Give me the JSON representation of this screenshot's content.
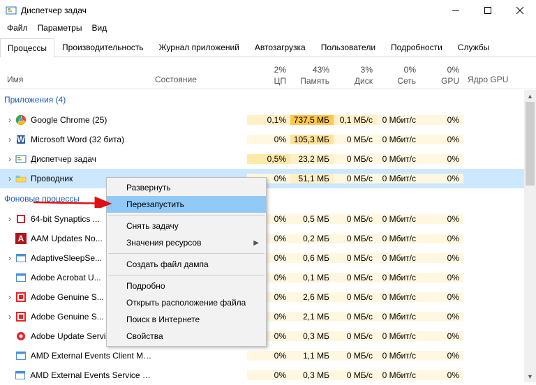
{
  "window": {
    "title": "Диспетчер задач"
  },
  "menu": [
    "Файл",
    "Параметры",
    "Вид"
  ],
  "tabs": [
    "Процессы",
    "Производительность",
    "Журнал приложений",
    "Автозагрузка",
    "Пользователи",
    "Подробности",
    "Службы"
  ],
  "header": {
    "name": "Имя",
    "state": "Состояние",
    "cols": [
      {
        "pct": "2%",
        "label": "ЦП"
      },
      {
        "pct": "43%",
        "label": "Память"
      },
      {
        "pct": "3%",
        "label": "Диск"
      },
      {
        "pct": "0%",
        "label": "Сеть"
      },
      {
        "pct": "0%",
        "label": "GPU"
      }
    ],
    "gpu_engine": "Ядро GPU"
  },
  "groups": {
    "apps": "Приложения (4)",
    "bg": "Фоновые процессы"
  },
  "rows": [
    {
      "exp": true,
      "icon": "chrome",
      "name": "Google Chrome (25)",
      "cpu": "0,1%",
      "mem": "737,5 МБ",
      "disk": "0,1 МБ/с",
      "net": "0 Мбит/с",
      "gpu": "0%",
      "cpu_bg": "bg1",
      "mem_bg": "bgm3",
      "disk_bg": "bg1",
      "net_bg": "bg0",
      "gpu_bg": "bg0"
    },
    {
      "exp": true,
      "icon": "word",
      "name": "Microsoft Word (32 бита)",
      "cpu": "0%",
      "mem": "105,3 МБ",
      "disk": "0 МБ/с",
      "net": "0 Мбит/с",
      "gpu": "0%",
      "cpu_bg": "bg0",
      "mem_bg": "bgm2",
      "disk_bg": "bg0",
      "net_bg": "bg0",
      "gpu_bg": "bg0"
    },
    {
      "exp": true,
      "icon": "tm",
      "name": "Диспетчер задач",
      "cpu": "0,5%",
      "mem": "23,2 МБ",
      "disk": "0 МБ/с",
      "net": "0 Мбит/с",
      "gpu": "0%",
      "cpu_bg": "bg2",
      "mem_bg": "bgm1",
      "disk_bg": "bg0",
      "net_bg": "bg0",
      "gpu_bg": "bg0"
    },
    {
      "exp": true,
      "icon": "explorer",
      "name": "Проводник",
      "cpu": "0%",
      "mem": "51,1 МБ",
      "disk": "0 МБ/с",
      "net": "0 Мбит/с",
      "gpu": "0%",
      "cpu_bg": "bg0",
      "mem_bg": "bgm1",
      "disk_bg": "bg0",
      "net_bg": "bg0",
      "gpu_bg": "bg0",
      "sel": true
    }
  ],
  "bg_rows": [
    {
      "exp": true,
      "icon": "box-red",
      "name": "64-bit Synaptics ...",
      "cpu": "0%",
      "mem": "0,5 МБ",
      "disk": "0 МБ/с",
      "net": "0 Мбит/с",
      "gpu": "0%"
    },
    {
      "exp": false,
      "icon": "adobe-a",
      "name": "AAM Updates No...",
      "cpu": "0%",
      "mem": "0,2 МБ",
      "disk": "0 МБ/с",
      "net": "0 Мбит/с",
      "gpu": "0%"
    },
    {
      "exp": true,
      "icon": "window",
      "name": "AdaptiveSleepSe...",
      "cpu": "0%",
      "mem": "0,6 МБ",
      "disk": "0 МБ/с",
      "net": "0 Мбит/с",
      "gpu": "0%"
    },
    {
      "exp": false,
      "icon": "window",
      "name": "Adobe Acrobat U...",
      "cpu": "0%",
      "mem": "0,1 МБ",
      "disk": "0 МБ/с",
      "net": "0 Мбит/с",
      "gpu": "0%"
    },
    {
      "exp": true,
      "icon": "adobe-red",
      "name": "Adobe Genuine S...",
      "cpu": "0%",
      "mem": "2,6 МБ",
      "disk": "0 МБ/с",
      "net": "0 Мбит/с",
      "gpu": "0%"
    },
    {
      "exp": true,
      "icon": "adobe-red",
      "name": "Adobe Genuine S...",
      "cpu": "0%",
      "mem": "2,1 МБ",
      "disk": "0 МБ/с",
      "net": "0 Мбит/с",
      "gpu": "0%"
    },
    {
      "exp": false,
      "icon": "adobe-gear",
      "name": "Adobe Update Service (32 бита)",
      "cpu": "0%",
      "mem": "0,3 МБ",
      "disk": "0 МБ/с",
      "net": "0 Мбит/с",
      "gpu": "0%"
    },
    {
      "exp": false,
      "icon": "window",
      "name": "AMD External Events Client Mo...",
      "cpu": "0%",
      "mem": "1,1 МБ",
      "disk": "0 МБ/с",
      "net": "0 Мбит/с",
      "gpu": "0%"
    },
    {
      "exp": false,
      "icon": "window",
      "name": "AMD External Events Service Mo...",
      "cpu": "0%",
      "mem": "0,3 МБ",
      "disk": "0 МБ/с",
      "net": "0 Мбит/с",
      "gpu": "0%"
    }
  ],
  "context_menu": {
    "items": [
      {
        "label": "Развернуть"
      },
      {
        "label": "Перезапустить",
        "hl": true
      },
      {
        "sep": true
      },
      {
        "label": "Снять задачу"
      },
      {
        "label": "Значения ресурсов",
        "sub": true
      },
      {
        "sep": true
      },
      {
        "label": "Создать файл дампа"
      },
      {
        "sep": true
      },
      {
        "label": "Подробно"
      },
      {
        "label": "Открыть расположение файла"
      },
      {
        "label": "Поиск в Интернете"
      },
      {
        "label": "Свойства"
      }
    ]
  }
}
